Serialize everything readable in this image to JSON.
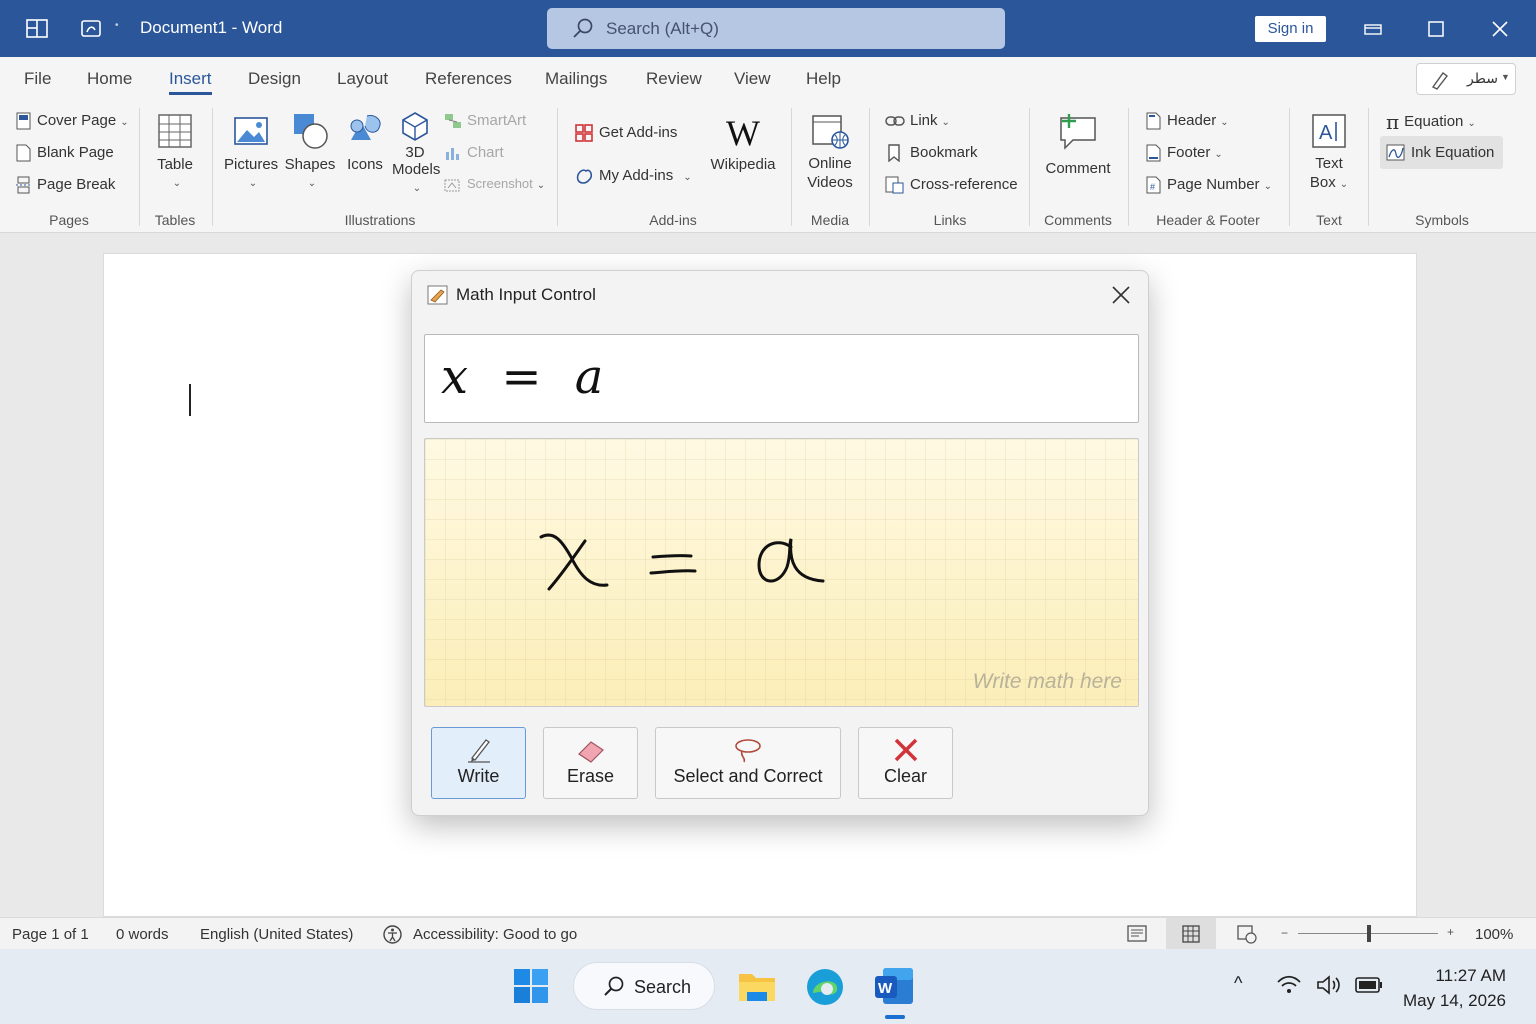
{
  "titlebar": {
    "doc_title": "Document1 - Word",
    "search_placeholder": "Search (Alt+Q)",
    "sign_in": "Sign in"
  },
  "menu": {
    "tabs": [
      "File",
      "Home",
      "Insert",
      "Design",
      "Layout",
      "References",
      "Mailings",
      "Review",
      "View",
      "Help"
    ],
    "active": "Insert",
    "editor_label": "سطر"
  },
  "ribbon": {
    "pages": {
      "cover_page": "Cover Page",
      "blank_page": "Blank Page",
      "page_break": "Page Break",
      "label": "Pages"
    },
    "tables": {
      "table": "Table",
      "label": "Tables"
    },
    "illustrations": {
      "pictures": "Pictures",
      "shapes": "Shapes",
      "icons": "Icons",
      "models_3d_line1": "3D",
      "models_3d_line2": "Models",
      "smartart": "SmartArt",
      "chart": "Chart",
      "screenshot": "Screenshot",
      "label": "Illustrations"
    },
    "addins": {
      "get_addins": "Get Add-ins",
      "my_addins": "My Add-ins",
      "wikipedia": "Wikipedia",
      "label": "Add-ins"
    },
    "media": {
      "online_videos_line1": "Online",
      "online_videos_line2": "Videos",
      "label": "Media"
    },
    "links": {
      "link": "Link",
      "bookmark": "Bookmark",
      "cross_reference": "Cross-reference",
      "label": "Links"
    },
    "comments": {
      "comment": "Comment",
      "label": "Comments"
    },
    "header_footer": {
      "header": "Header",
      "footer": "Footer",
      "page_number": "Page Number",
      "label": "Header & Footer"
    },
    "text": {
      "text_box_line1": "Text",
      "text_box_line2": "Box",
      "label": "Text"
    },
    "symbols": {
      "equation": "Equation",
      "ink_equation": "Ink Equation",
      "label": "Symbols"
    }
  },
  "dialog": {
    "title": "Math Input Control",
    "preview": "x = a",
    "hint": "Write math here",
    "buttons": {
      "write": "Write",
      "erase": "Erase",
      "select_correct": "Select and Correct",
      "clear": "Clear"
    }
  },
  "status": {
    "page": "Page 1 of 1",
    "words": "0 words",
    "language": "English (United States)",
    "accessibility": "Accessibility: Good to go",
    "zoom": "100%"
  },
  "taskbar": {
    "search": "Search",
    "time": "11:27 AM",
    "date": "May 14, 2026"
  },
  "colors": {
    "accent": "#2b579a",
    "pad": "#fdf3c7",
    "clear_red": "#d13438"
  }
}
